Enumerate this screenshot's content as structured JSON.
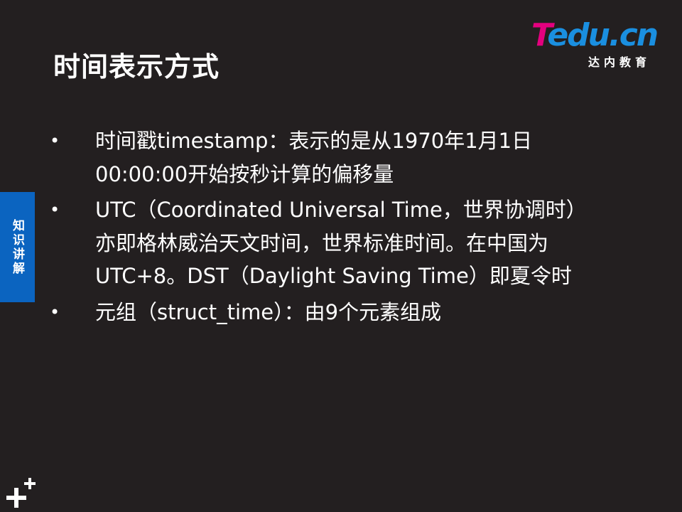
{
  "title": "时间表示方式",
  "logo": {
    "brand_first": "T",
    "brand_rest": "edu.cn",
    "subtitle": "达内教育",
    "colors": {
      "pink": "#e4007f",
      "blue": "#1a8fe0"
    }
  },
  "side_tab": {
    "label": "知识讲解",
    "color": "#0b64c0"
  },
  "bullets": [
    {
      "marker": "•",
      "text": "时间戳timestamp：表示的是从1970年1月1日\n00:00:00开始按秒计算的偏移量"
    },
    {
      "marker": "•",
      "text": "UTC（Coordinated Universal Time，世界协调时）\n亦即格林威治天文时间，世界标准时间。在中国为\nUTC+8。DST（Daylight Saving Time）即夏令时"
    },
    {
      "marker": "•",
      "text": "元组（struct_time）：由9个元素组成"
    }
  ],
  "background_color": "#231f20",
  "decor_icon": "plus-plus-icon"
}
